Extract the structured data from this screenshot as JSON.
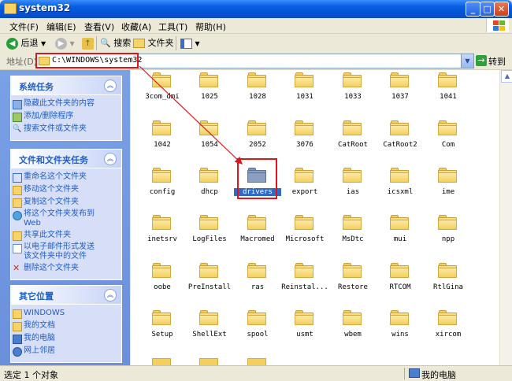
{
  "window": {
    "title": "system32"
  },
  "menu": [
    "文件(F)",
    "编辑(E)",
    "查看(V)",
    "收藏(A)",
    "工具(T)",
    "帮助(H)"
  ],
  "toolbar": {
    "back": "后退",
    "search": "搜索",
    "folders": "文件夹"
  },
  "address": {
    "label": "地址(D)",
    "path": "C:\\WINDOWS\\system32",
    "go": "转到"
  },
  "sidebar": {
    "system_tasks": {
      "title": "系统任务",
      "items": [
        "隐藏此文件夹的内容",
        "添加/删除程序",
        "搜索文件或文件夹"
      ]
    },
    "file_tasks": {
      "title": "文件和文件夹任务",
      "items": [
        "重命名这个文件夹",
        "移动这个文件夹",
        "复制这个文件夹",
        "将这个文件夹发布到",
        "Web",
        "共享此文件夹",
        "以电子邮件形式发送",
        "该文件夹中的文件",
        "删除这个文件夹"
      ]
    },
    "other_places": {
      "title": "其它位置",
      "items": [
        "WINDOWS",
        "我的文档",
        "我的电脑",
        "网上邻居"
      ]
    }
  },
  "folders": [
    "3com_dmi",
    "1025",
    "1028",
    "1031",
    "1033",
    "1037",
    "1041",
    "1042",
    "1054",
    "2052",
    "3076",
    "CatRoot",
    "CatRoot2",
    "Com",
    "config",
    "dhcp",
    "drivers",
    "export",
    "ias",
    "icsxml",
    "ime",
    "inetsrv",
    "LogFiles",
    "Macromed",
    "Microsoft",
    "MsDtc",
    "mui",
    "npp",
    "oobe",
    "PreInstall",
    "ras",
    "Reinstal...",
    "Restore",
    "RTCOM",
    "RtlGina",
    "Setup",
    "ShellExt",
    "spool",
    "usmt",
    "wbem",
    "wins",
    "xircom"
  ],
  "selected_folder": "drivers",
  "status": {
    "left": "选定 1 个对象",
    "right": "我的电脑"
  },
  "colors": {
    "accent": "#316ac5",
    "highlight_box": "#e1131b",
    "title_bar": "#0453d6"
  }
}
